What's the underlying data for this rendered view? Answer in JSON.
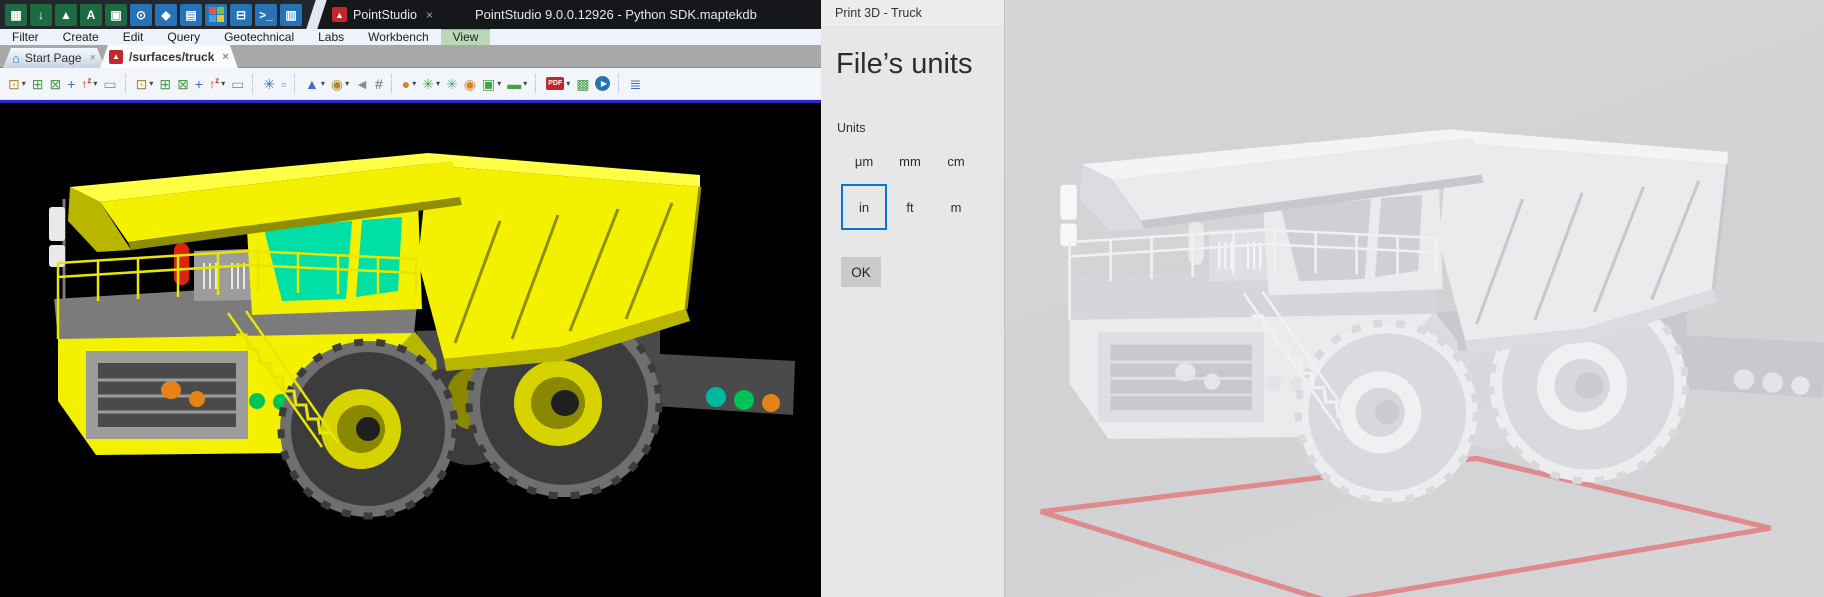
{
  "app": {
    "close_glyph": "×",
    "logo_glyph": "▲",
    "titlebar": {
      "tab_label": "PointStudio",
      "title": "PointStudio 9.0.0.12926 - Python SDK.maptekdb",
      "icons": [
        {
          "name": "report-icon",
          "glyph": "▦",
          "bg": "#1d6b43"
        },
        {
          "name": "import-icon",
          "glyph": "↓",
          "bg": "#1d6b43"
        },
        {
          "name": "terrain-icon",
          "glyph": "▲",
          "bg": "#1d6b43"
        },
        {
          "name": "label-icon",
          "glyph": "A",
          "bg": "#1d6b43"
        },
        {
          "name": "structure-icon",
          "glyph": "▣",
          "bg": "#1d6b43"
        },
        {
          "name": "pin-icon",
          "glyph": "⊙",
          "bg": "#2673b8"
        },
        {
          "name": "solids-icon",
          "glyph": "◆",
          "bg": "#2673b8"
        },
        {
          "name": "document-icon",
          "glyph": "▤",
          "bg": "#2673b8"
        },
        {
          "name": "windows-logo-icon",
          "glyph": "",
          "bg": "#2673b8",
          "win_colors": [
            "#e8543c",
            "#7bc043",
            "#4aa3df",
            "#f2c431"
          ]
        },
        {
          "name": "print-layout-icon",
          "glyph": "⊟",
          "bg": "#2673b8"
        },
        {
          "name": "console-icon",
          "glyph": ">_",
          "bg": "#2673b8"
        },
        {
          "name": "shell-icon",
          "glyph": "▥",
          "bg": "#2673b8"
        }
      ]
    },
    "menubar": {
      "items": [
        "Filter",
        "Create",
        "Edit",
        "Query",
        "Geotechnical",
        "Labs",
        "Workbench",
        "View"
      ],
      "active_index": 7
    },
    "doc_tabs": [
      {
        "label": "Start Page",
        "icon": "home-icon",
        "glyph": "⌂",
        "active": false
      },
      {
        "label": "/surfaces/truck",
        "icon": "pointstudio-logo",
        "logo": true,
        "active": true
      }
    ],
    "toolbar": {
      "groups": [
        [
          {
            "name": "view-cube-icon",
            "glyph": "⊡",
            "c": "#b08a2a",
            "dd": true
          },
          {
            "name": "zoom-extents-icon",
            "glyph": "⊞",
            "c": "#4e9a4e"
          },
          {
            "name": "zoom-window-icon",
            "glyph": "⊠",
            "c": "#4e9a4e"
          },
          {
            "name": "pick-icon",
            "glyph": "+",
            "c": "#3a6fd0"
          },
          {
            "name": "look-down-z-icon",
            "glyph": "↑z",
            "c": "#cc3322",
            "dd": true,
            "upz": true
          },
          {
            "name": "new-view-icon",
            "glyph": "▭",
            "c": "#8090a0"
          }
        ],
        [
          {
            "name": "view-cube-2-icon",
            "glyph": "⊡",
            "c": "#b08a2a",
            "dd": true
          },
          {
            "name": "zoom-extents-2-icon",
            "glyph": "⊞",
            "c": "#4e9a4e"
          },
          {
            "name": "zoom-window-2-icon",
            "glyph": "⊠",
            "c": "#4e9a4e"
          },
          {
            "name": "pick-2-icon",
            "glyph": "+",
            "c": "#3a6fd0"
          },
          {
            "name": "look-down-z-2-icon",
            "glyph": "↑z",
            "c": "#cc3322",
            "dd": true,
            "upz": true
          },
          {
            "name": "new-view-2-icon",
            "glyph": "▭",
            "c": "#8090a0"
          }
        ],
        [
          {
            "name": "refresh-view-icon",
            "glyph": "✳",
            "c": "#3a6fd0"
          },
          {
            "name": "dock-window-icon",
            "glyph": "▫",
            "c": "#8090a0"
          }
        ],
        [
          {
            "name": "north-arrow-icon",
            "glyph": "▲",
            "c": "#3a6fd0",
            "dd": true
          },
          {
            "name": "lighting-icon",
            "glyph": "◉",
            "c": "#b08a2a",
            "dd": true
          },
          {
            "name": "sound-icon",
            "glyph": "◄",
            "c": "#8090a0"
          },
          {
            "name": "grid-icon",
            "glyph": "#",
            "c": "#606870"
          }
        ],
        [
          {
            "name": "render-sphere-icon",
            "glyph": "●",
            "c": "#dd8422",
            "dd": true
          },
          {
            "name": "points-icon",
            "glyph": "✳",
            "c": "#45a345",
            "dd": true
          },
          {
            "name": "snap-icon",
            "glyph": "✳",
            "c": "#3fae8f"
          },
          {
            "name": "avatar-icon",
            "glyph": "◉",
            "c": "#dd8422"
          },
          {
            "name": "window-layout-icon",
            "glyph": "▣",
            "c": "#45a345",
            "dd": true
          },
          {
            "name": "measure-icon",
            "glyph": "▬",
            "c": "#45a345",
            "dd": true
          }
        ],
        [
          {
            "name": "export-pdf-icon",
            "glyph": "PDF",
            "c": "#c1272d",
            "dd": true,
            "badge": true
          },
          {
            "name": "screenshot-icon",
            "glyph": "▩",
            "c": "#4e9a4e"
          },
          {
            "name": "play-animation-icon",
            "glyph": "▶",
            "c": "#2673b8",
            "circle": true
          }
        ],
        [
          {
            "name": "layer-list-icon",
            "glyph": "≣",
            "c": "#3a6fd0"
          }
        ]
      ]
    }
  },
  "print3d": {
    "window_title": "Print 3D - Truck",
    "heading": "File’s units",
    "units_label": "Units",
    "unit_options": [
      "μm",
      "mm",
      "cm",
      "in",
      "ft",
      "m"
    ],
    "selected_unit": "in",
    "selected_index": 3,
    "ok_label": "OK"
  },
  "colors": {
    "selection_blue": "#0078d7",
    "menu_active_green": "#b9d9b6",
    "pointstudio_logo_red": "#c1272d",
    "viewport_border_blue": "#2626d0",
    "truck_yellow": "#f4f100",
    "windshield_teal": "#00dfa6",
    "print_bed_red": "#e08b8b"
  }
}
